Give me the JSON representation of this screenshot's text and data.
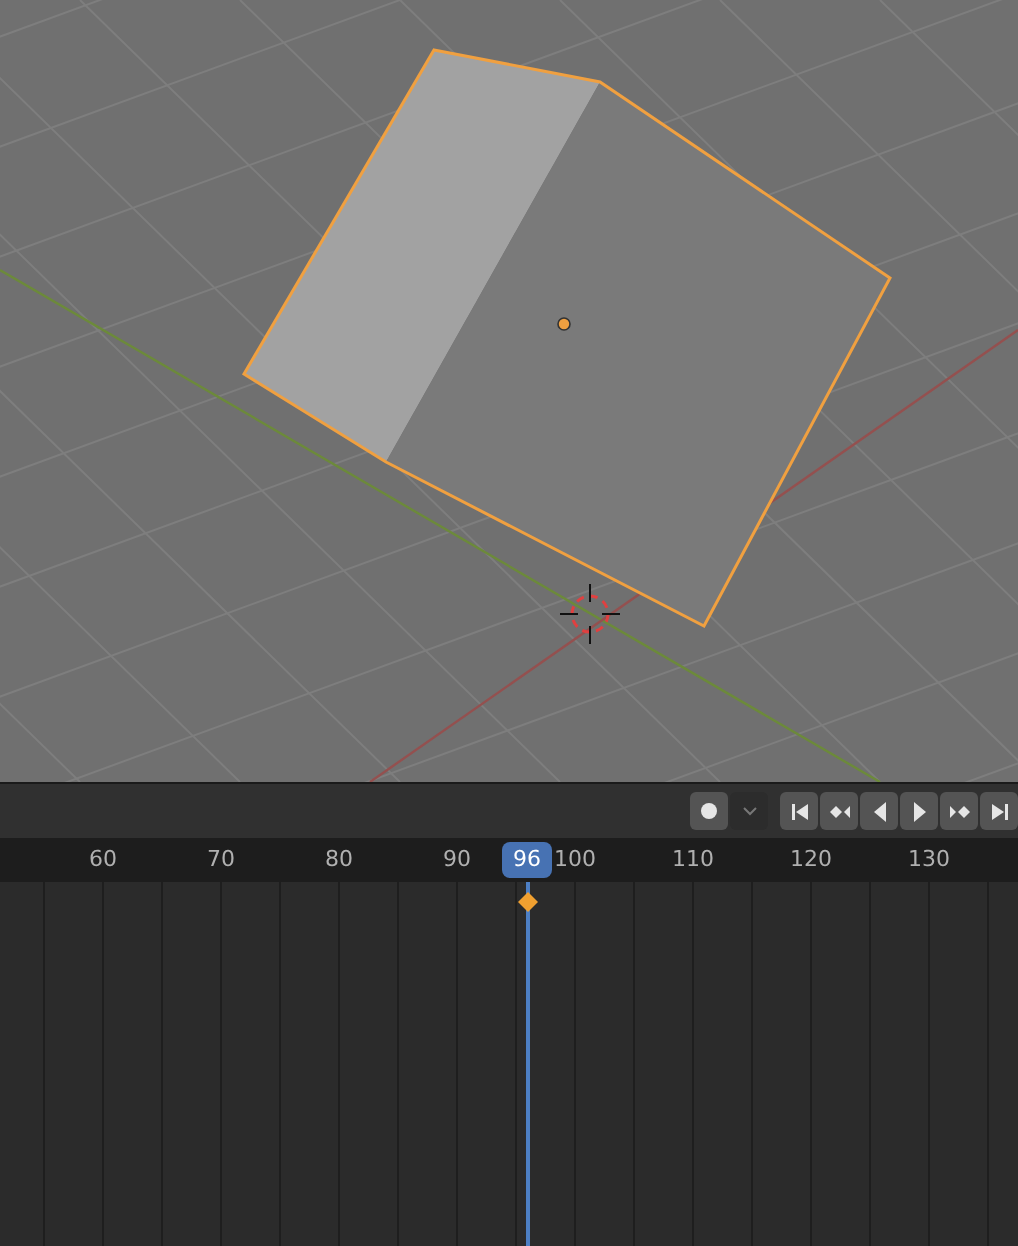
{
  "timeline": {
    "auto_keying": {
      "on": false
    },
    "transport": [
      {
        "kind": "jump-start"
      },
      {
        "kind": "prev-key"
      },
      {
        "kind": "play-reverse"
      },
      {
        "kind": "play"
      },
      {
        "kind": "next-key"
      },
      {
        "kind": "jump-end"
      }
    ],
    "ruler_labels": [
      "60",
      "70",
      "80",
      "90",
      "100",
      "110",
      "120",
      "130"
    ],
    "current_frame": "96"
  }
}
